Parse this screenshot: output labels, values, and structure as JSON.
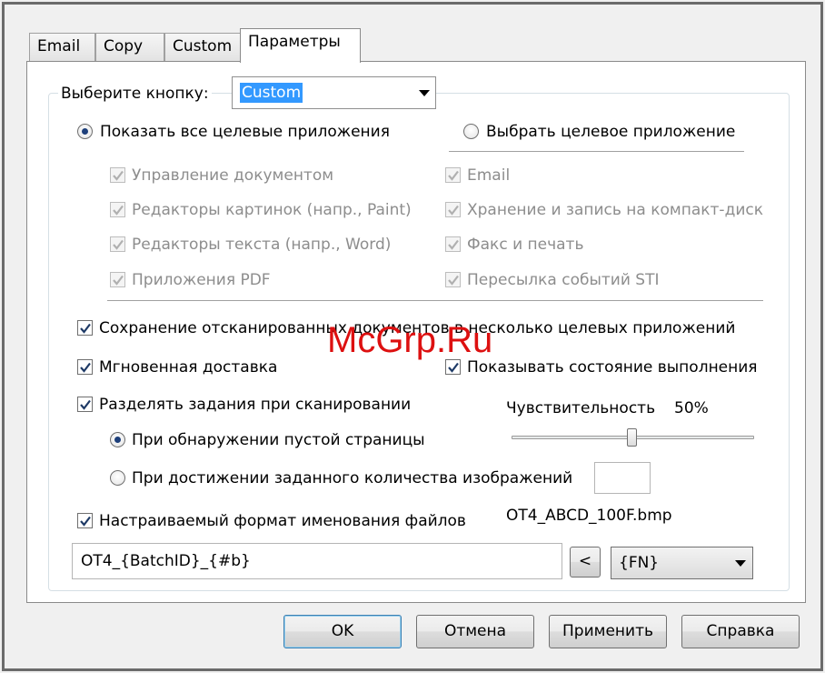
{
  "tabs": [
    {
      "label": "Email",
      "active": false
    },
    {
      "label": "Copy",
      "active": false
    },
    {
      "label": "Custom",
      "active": false
    },
    {
      "label": "Параметры",
      "active": true
    }
  ],
  "button_select": {
    "label": "Выберите кнопку:",
    "value": "Custom"
  },
  "target_mode": {
    "show_all_label": "Показать все целевые приложения",
    "show_all_selected": true,
    "choose_label": "Выбрать целевое приложение",
    "choose_selected": false
  },
  "apps_left": [
    {
      "label": "Управление документом",
      "checked": true
    },
    {
      "label": "Редакторы картинок (напр., Paint)",
      "checked": true
    },
    {
      "label": "Редакторы текста (напр., Word)",
      "checked": true
    },
    {
      "label": "Приложения PDF",
      "checked": true
    }
  ],
  "apps_right": [
    {
      "label": "Email",
      "checked": true
    },
    {
      "label": "Хранение и запись на компакт-диск",
      "checked": true
    },
    {
      "label": "Факс и печать",
      "checked": true
    },
    {
      "label": "Пересылка событий STI",
      "checked": true
    }
  ],
  "options": {
    "multi_target": {
      "label": "Сохранение отсканированных документов в несколько целевых приложений",
      "checked": true
    },
    "instant_delivery": {
      "label": "Мгновенная доставка",
      "checked": true
    },
    "show_progress": {
      "label": "Показывать состояние выполнения",
      "checked": true
    },
    "split_jobs": {
      "label": "Разделять задания при сканировании",
      "checked": true
    }
  },
  "split": {
    "blank_page": {
      "label": "При обнаружении пустой страницы",
      "selected": true
    },
    "image_count": {
      "label": "При достижении заданного количества изображений",
      "selected": false,
      "value": ""
    },
    "sensitivity_label": "Чувствительность",
    "sensitivity_value": "50%",
    "sensitivity_level": 0.5
  },
  "naming": {
    "label": "Настраиваемый формат именования файлов",
    "checked": true,
    "preview": "OT4_ABCD_100F.bmp",
    "format": "OT4_{BatchID}_{#b}",
    "insert_label": "<",
    "token": "{FN}"
  },
  "buttons": {
    "ok": "OK",
    "cancel": "Отмена",
    "apply": "Применить",
    "help": "Справка"
  },
  "watermark": "McGrp.Ru"
}
